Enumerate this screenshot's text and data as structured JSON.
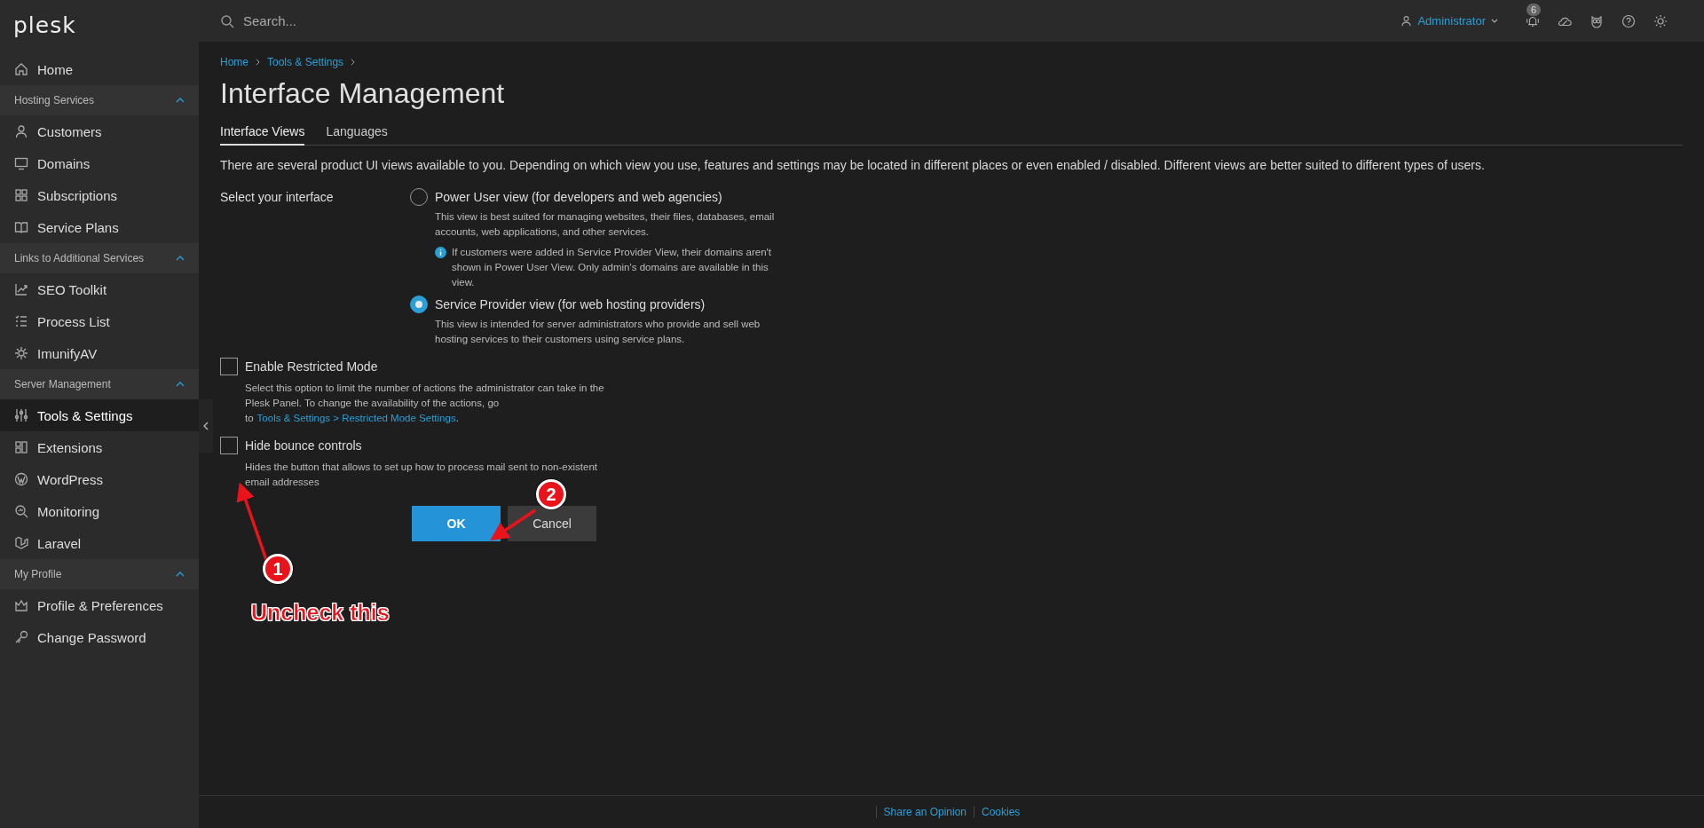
{
  "sidebar": {
    "logo": "plesk",
    "home": {
      "label": "Home",
      "selected": false
    },
    "sections": [
      {
        "title": "Hosting Services",
        "expanded": true,
        "items": [
          {
            "label": "Customers",
            "selected": false
          },
          {
            "label": "Domains",
            "selected": false
          },
          {
            "label": "Subscriptions",
            "selected": false
          },
          {
            "label": "Service Plans",
            "selected": false
          }
        ]
      },
      {
        "title": "Links to Additional Services",
        "expanded": true,
        "items": [
          {
            "label": "SEO Toolkit",
            "selected": false
          },
          {
            "label": "Process List",
            "selected": false
          },
          {
            "label": "ImunifyAV",
            "selected": false
          }
        ]
      },
      {
        "title": "Server Management",
        "expanded": true,
        "items": [
          {
            "label": "Tools & Settings",
            "selected": true
          },
          {
            "label": "Extensions",
            "selected": false
          },
          {
            "label": "WordPress",
            "selected": false
          },
          {
            "label": "Monitoring",
            "selected": false
          },
          {
            "label": "Laravel",
            "selected": false
          }
        ]
      },
      {
        "title": "My Profile",
        "expanded": true,
        "items": [
          {
            "label": "Profile & Preferences",
            "selected": false
          },
          {
            "label": "Change Password",
            "selected": false
          }
        ]
      }
    ]
  },
  "topbar": {
    "search": {
      "placeholder": "Search..."
    },
    "user": "Administrator",
    "notifications": "6"
  },
  "breadcrumbs": [
    "Home",
    "Tools & Settings"
  ],
  "title": "Interface Management",
  "tabs": [
    {
      "label": "Interface Views",
      "selected": true
    },
    {
      "label": "Languages",
      "selected": false
    }
  ],
  "intro": "There are several product UI views available to you. Depending on which view you use, features and settings may be located in different places or even enabled / disabled. Different views are better suited to different types of users.",
  "select_label": "Select your interface",
  "views": [
    {
      "label": "Power User view (for developers and web agencies)",
      "selected": false,
      "description": "This view is best suited for managing websites, their files, databases, email accounts, web applications, and other services.",
      "note": "If customers were added in Service Provider View, their domains aren't shown in Power User View. Only admin's domains are available in this view."
    },
    {
      "label": "Service Provider view (for web hosting providers)",
      "selected": true,
      "description": "This view is intended for server administrators who provide and sell web hosting services to their customers using service plans."
    }
  ],
  "options": [
    {
      "label": "Enable Restricted Mode",
      "checked": false,
      "description": "Select this option to limit the number of actions the administrator can take in the Plesk Panel. To change the availability of the actions, go to",
      "link": "Tools & Settings > Restricted Mode Settings",
      "link_suffix": "."
    },
    {
      "label": "Hide bounce controls",
      "checked": false,
      "description": "Hides the button that allows to set up how to process mail sent to non-existent email addresses"
    }
  ],
  "buttons": [
    {
      "label": "OK",
      "kind": "primary"
    },
    {
      "label": "Cancel",
      "kind": "secondary"
    }
  ],
  "footer": [
    "Share an Opinion",
    "Cookies"
  ],
  "annotations": {
    "markers": [
      "1",
      "2"
    ],
    "note": "Uncheck this"
  }
}
